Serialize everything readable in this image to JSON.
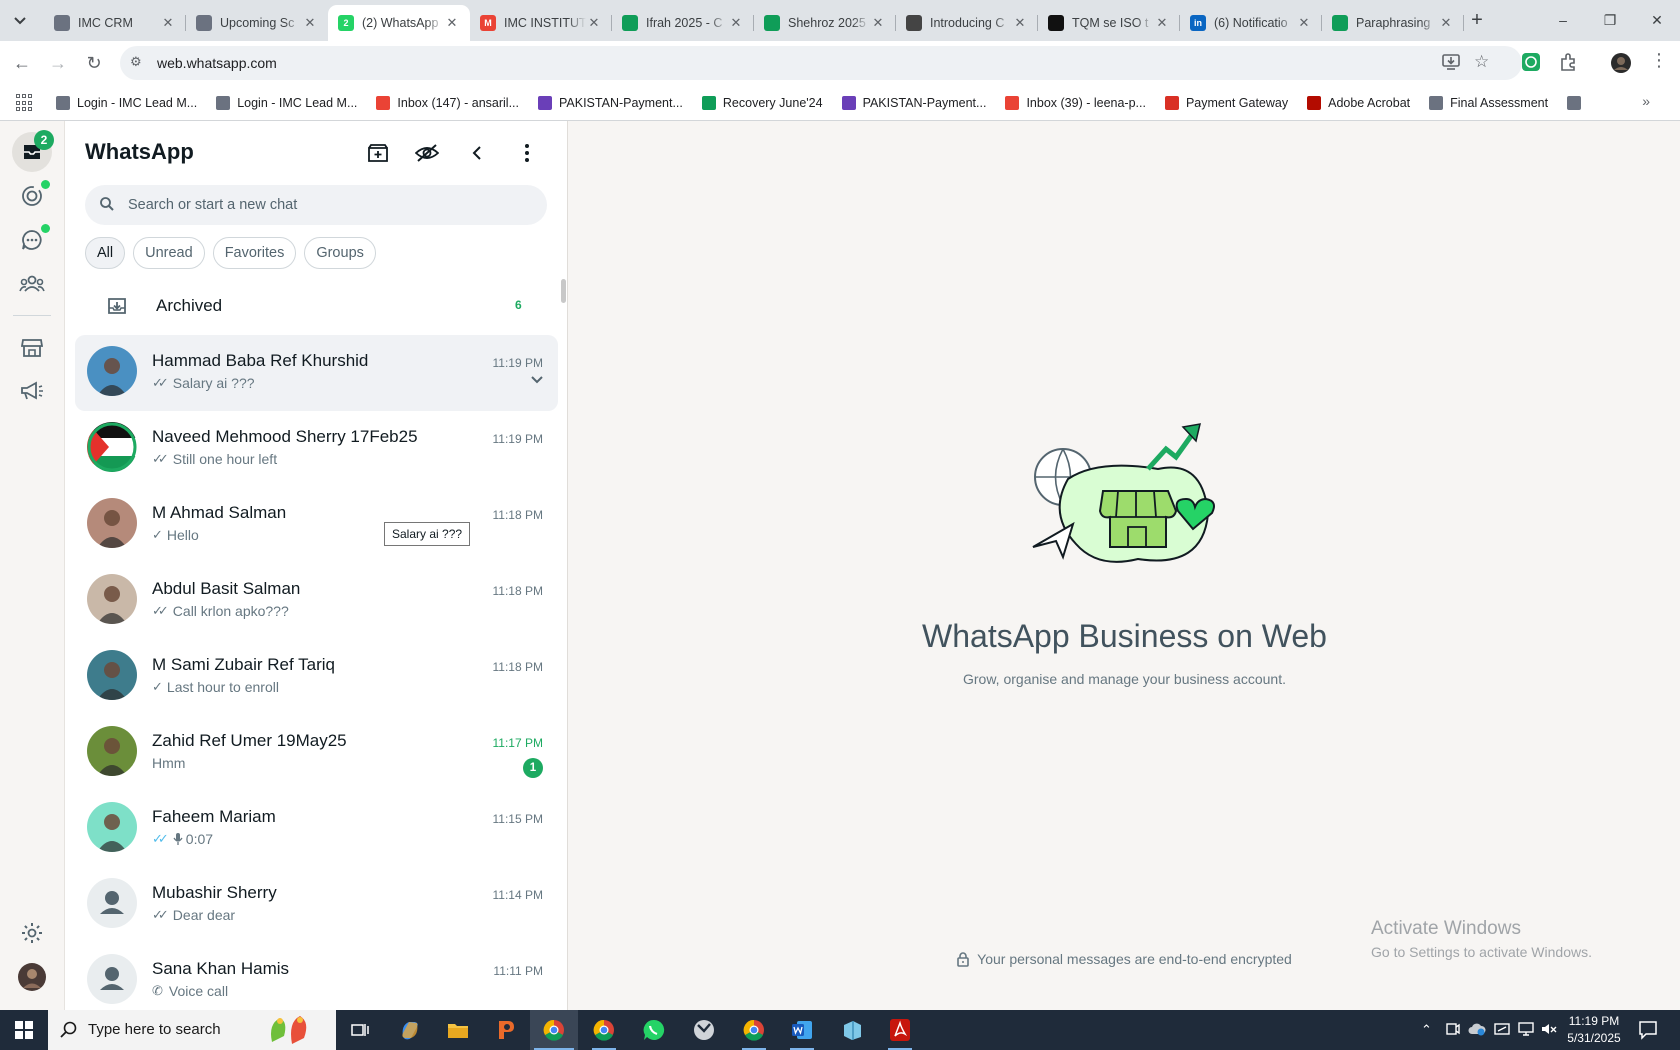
{
  "browser": {
    "tabs": [
      {
        "title": "IMC CRM",
        "favicon_color": "#6b7280"
      },
      {
        "title": "Upcoming Sc",
        "favicon_color": "#6b7280"
      },
      {
        "title": "(2) WhatsApp",
        "favicon_color": "#25d366",
        "favicon_text": "2",
        "active": true
      },
      {
        "title": "IMC INSTITUT",
        "favicon_color": "#ea4335",
        "favicon_text": "M"
      },
      {
        "title": "Ifrah 2025 - C",
        "favicon_color": "#0f9d58"
      },
      {
        "title": "Shehroz 2025",
        "favicon_color": "#0f9d58"
      },
      {
        "title": "Introducing C",
        "favicon_color": "#444"
      },
      {
        "title": "TQM se ISO t",
        "favicon_color": "#111"
      },
      {
        "title": "(6) Notificatio",
        "favicon_color": "#0a66c2",
        "favicon_text": "in"
      },
      {
        "title": "Paraphrasing",
        "favicon_color": "#0f9d58"
      }
    ],
    "url": "web.whatsapp.com",
    "bookmarks": [
      {
        "label": "Login - IMC Lead M...",
        "color": "#6b7280"
      },
      {
        "label": "Login - IMC Lead M...",
        "color": "#6b7280"
      },
      {
        "label": "Inbox (147) - ansaril...",
        "color": "#ea4335"
      },
      {
        "label": "PAKISTAN-Payment...",
        "color": "#6a3fb8"
      },
      {
        "label": "Recovery June'24",
        "color": "#0f9d58"
      },
      {
        "label": "PAKISTAN-Payment...",
        "color": "#6a3fb8"
      },
      {
        "label": "Inbox (39) - leena-p...",
        "color": "#ea4335"
      },
      {
        "label": "Payment Gateway",
        "color": "#d93025"
      },
      {
        "label": "Adobe Acrobat",
        "color": "#b30b00"
      },
      {
        "label": "Final Assessment",
        "color": "#6b7280"
      }
    ]
  },
  "rail": {
    "chats_badge": "2"
  },
  "sidebar": {
    "title": "WhatsApp",
    "search_placeholder": "Search or start a new chat",
    "filters": [
      "All",
      "Unread",
      "Favorites",
      "Groups"
    ],
    "archived_label": "Archived",
    "archived_count": "6",
    "chats": [
      {
        "name": "Hammad Baba Ref Khurshid",
        "time": "11:19 PM",
        "preview": "Salary ai ???",
        "ticks": "double",
        "hover": true,
        "avatar": "#4a90c2"
      },
      {
        "name": "Naveed Mehmood Sherry 17Feb25",
        "time": "11:19 PM",
        "preview": "Still one hour left",
        "ticks": "double",
        "avatar": "flag"
      },
      {
        "name": "M Ahmad Salman",
        "time": "11:18 PM",
        "preview": "Hello",
        "ticks": "single",
        "avatar": "#b58a7a"
      },
      {
        "name": "Abdul Basit Salman",
        "time": "11:18 PM",
        "preview": "Call krlon apko???",
        "ticks": "double",
        "avatar": "#c9b8a8"
      },
      {
        "name": "M Sami Zubair Ref Tariq",
        "time": "11:18 PM",
        "preview": "Last hour to enroll",
        "ticks": "single",
        "avatar": "#3e7c8c"
      },
      {
        "name": "Zahid Ref Umer 19May25",
        "time": "11:17 PM",
        "preview": "Hmm",
        "ticks": "none",
        "unread": "1",
        "avatar": "#6b8e3a"
      },
      {
        "name": "Faheem Mariam",
        "time": "11:15 PM",
        "preview": "0:07",
        "ticks": "read",
        "voice": true,
        "avatar": "#7ee0c8"
      },
      {
        "name": "Mubashir Sherry",
        "time": "11:14 PM",
        "preview": "Dear dear",
        "ticks": "double",
        "avatar": "default"
      },
      {
        "name": "Sana Khan Hamis",
        "time": "11:11 PM",
        "preview": "Voice call",
        "ticks": "call",
        "avatar": "default"
      }
    ],
    "tooltip": "Salary ai ???"
  },
  "main": {
    "title": "WhatsApp Business on Web",
    "subtitle": "Grow, organise and manage your business account.",
    "encrypted_note": "Your personal messages are end-to-end encrypted",
    "activate_title": "Activate Windows",
    "activate_sub": "Go to Settings to activate Windows."
  },
  "taskbar": {
    "search_placeholder": "Type here to search",
    "time": "11:19 PM",
    "date": "5/31/2025"
  },
  "colors": {
    "accent": "#1daa61",
    "badge_green": "#25d366",
    "read_ticks": "#53bdeb"
  }
}
